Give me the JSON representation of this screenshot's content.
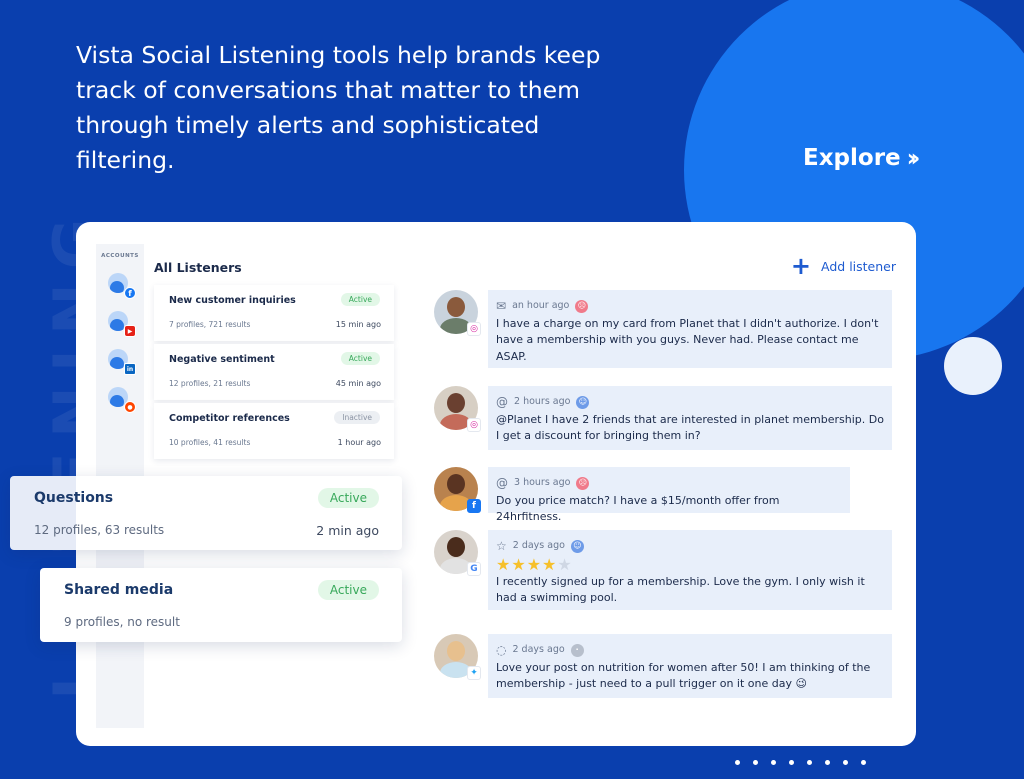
{
  "hero": {
    "headline": "Vista Social Listening tools help brands keep track of conversations that matter to them through timely alerts and sophisticated filtering.",
    "explore_label": "Explore",
    "explore_icon": "double-chevron-right-icon",
    "watermark": "LISTENING"
  },
  "colors": {
    "background": "#0a3fae",
    "accent": "#1876ef",
    "active_badge": "#37a85a",
    "link": "#1e5bd0"
  },
  "accounts": {
    "title": "ACCOUNTS",
    "items": [
      {
        "network": "facebook",
        "badge": "f",
        "color": "#1877f2"
      },
      {
        "network": "youtube",
        "badge": "▶",
        "color": "#e62117"
      },
      {
        "network": "linkedin",
        "badge": "in",
        "color": "#0a66c2"
      },
      {
        "network": "reddit",
        "badge": "●",
        "color": "#ff4500"
      }
    ]
  },
  "listeners": {
    "title": "All Listeners",
    "add_label": "Add listener",
    "items": [
      {
        "name": "New customer inquiries",
        "meta": "7 profiles, 721 results",
        "status": "Active",
        "time": "15 min ago"
      },
      {
        "name": "Negative  sentiment",
        "meta": "12 profiles, 21 results",
        "status": "Active",
        "time": "45 min ago"
      },
      {
        "name": "Competitor references",
        "meta": "10 profiles, 41 results",
        "status": "Inactive",
        "time": "1 hour ago"
      }
    ],
    "highlighted": [
      {
        "name": "Questions",
        "meta": "12 profiles, 63 results",
        "status": "Active",
        "time": "2 min ago"
      },
      {
        "name": "Shared media",
        "meta": "9 profiles, no result",
        "status": "Active"
      }
    ]
  },
  "mentions": [
    {
      "network": "instagram",
      "type_icon": "envelope-icon",
      "time": "an hour ago",
      "sentiment": "negative",
      "text": "I have a charge on my card from Planet that I didn't authorize. I don't have a membership with you guys. Never had. Please contact me ASAP."
    },
    {
      "network": "instagram",
      "type_icon": "at-sign-icon",
      "time": "2 hours ago",
      "sentiment": "positive",
      "text": "@Planet I have 2 friends that are interested in planet membership. Do I get a discount for bringing them in?"
    },
    {
      "network": "facebook",
      "type_icon": "at-sign-icon",
      "time": "3 hours ago",
      "sentiment": "negative",
      "text": "Do you price match? I have a $15/month offer from 24hrfitness."
    },
    {
      "network": "google",
      "type_icon": "star-outline-icon",
      "time": "2 days ago",
      "sentiment": "positive",
      "rating": 4,
      "rating_max": 5,
      "text": "I recently signed up for a membership. Love the gym. I only wish it had a swimming pool."
    },
    {
      "network": "twitter",
      "type_icon": "comment-icon",
      "time": "2 days ago",
      "sentiment": "neutral",
      "text": "Love your post on nutrition for women after 50! I am thinking of the membership - just need to a pull trigger on it one day 😉"
    }
  ]
}
